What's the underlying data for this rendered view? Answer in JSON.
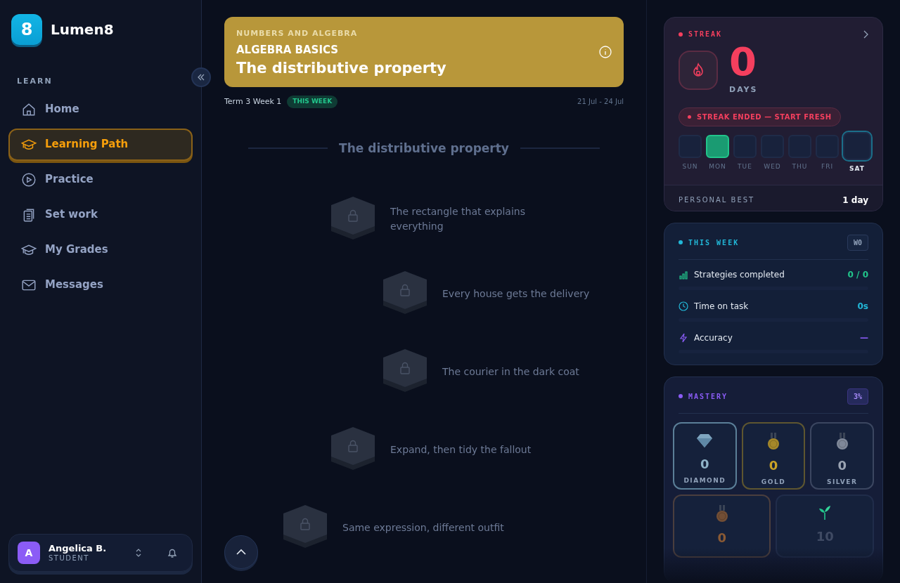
{
  "brand": {
    "logo": "8",
    "name": "Lumen8"
  },
  "sidebar": {
    "section": "LEARN",
    "items": [
      {
        "label": "Home",
        "kind": "home",
        "selected": false
      },
      {
        "label": "Learning Path",
        "kind": "cap",
        "selected": true
      },
      {
        "label": "Practice",
        "kind": "play",
        "selected": false
      },
      {
        "label": "Set work",
        "kind": "clipboard",
        "selected": false
      },
      {
        "label": "My Grades",
        "kind": "cap",
        "selected": false
      },
      {
        "label": "Messages",
        "kind": "mail",
        "selected": false
      }
    ]
  },
  "user": {
    "initial": "A",
    "name": "Angelica B.",
    "role": "STUDENT"
  },
  "banner": {
    "subject": "NUMBERS AND ALGEBRA",
    "unit": "ALGEBRA BASICS",
    "title": "The distributive property"
  },
  "term": {
    "label": "Term 3 Week 1",
    "badge": "THIS WEEK",
    "dates": "21 Jul - 24 Jul"
  },
  "path": {
    "heading": "The distributive property",
    "nodes": [
      {
        "title": "The rectangle that explains everything",
        "locked": true
      },
      {
        "title": "Every house gets the delivery",
        "locked": true
      },
      {
        "title": "The courier in the dark coat",
        "locked": true
      },
      {
        "title": "Expand, then tidy the fallout",
        "locked": true
      },
      {
        "title": "Same expression, different outfit",
        "locked": true
      }
    ]
  },
  "streak": {
    "title": "STREAK",
    "count": "0",
    "unit": "DAYS",
    "notice": "STREAK ENDED — START FRESH",
    "days": [
      {
        "label": "SUN",
        "done": false,
        "selected": false
      },
      {
        "label": "MON",
        "done": true,
        "selected": false
      },
      {
        "label": "TUE",
        "done": false,
        "selected": false
      },
      {
        "label": "WED",
        "done": false,
        "selected": false
      },
      {
        "label": "THU",
        "done": false,
        "selected": false
      },
      {
        "label": "FRI",
        "done": false,
        "selected": false
      },
      {
        "label": "SAT",
        "done": false,
        "selected": true
      }
    ],
    "best_label": "PERSONAL BEST",
    "best_value": "1 day"
  },
  "this_week": {
    "title": "THIS WEEK",
    "badge": "W0",
    "stats": [
      {
        "kind": "bars",
        "label": "Strategies completed",
        "value": "0 / 0",
        "color": "#22c58b",
        "level": 0
      },
      {
        "kind": "clock",
        "label": "Time on task",
        "value": "0s",
        "color": "#22b8d8",
        "level": 0
      },
      {
        "kind": "bolt",
        "label": "Accuracy",
        "value": "—",
        "color": "#8b5cf6",
        "level": 0
      }
    ]
  },
  "mastery": {
    "title": "MASTERY",
    "badge": "3%",
    "tiles": [
      {
        "kind": "diamond",
        "count": "0",
        "label": "DIAMOND"
      },
      {
        "kind": "gold",
        "count": "0",
        "label": "GOLD"
      },
      {
        "kind": "silver",
        "count": "0",
        "label": "SILVER"
      },
      {
        "kind": "bronze",
        "count": "0"
      },
      {
        "kind": "sprout",
        "count": "10"
      }
    ]
  }
}
